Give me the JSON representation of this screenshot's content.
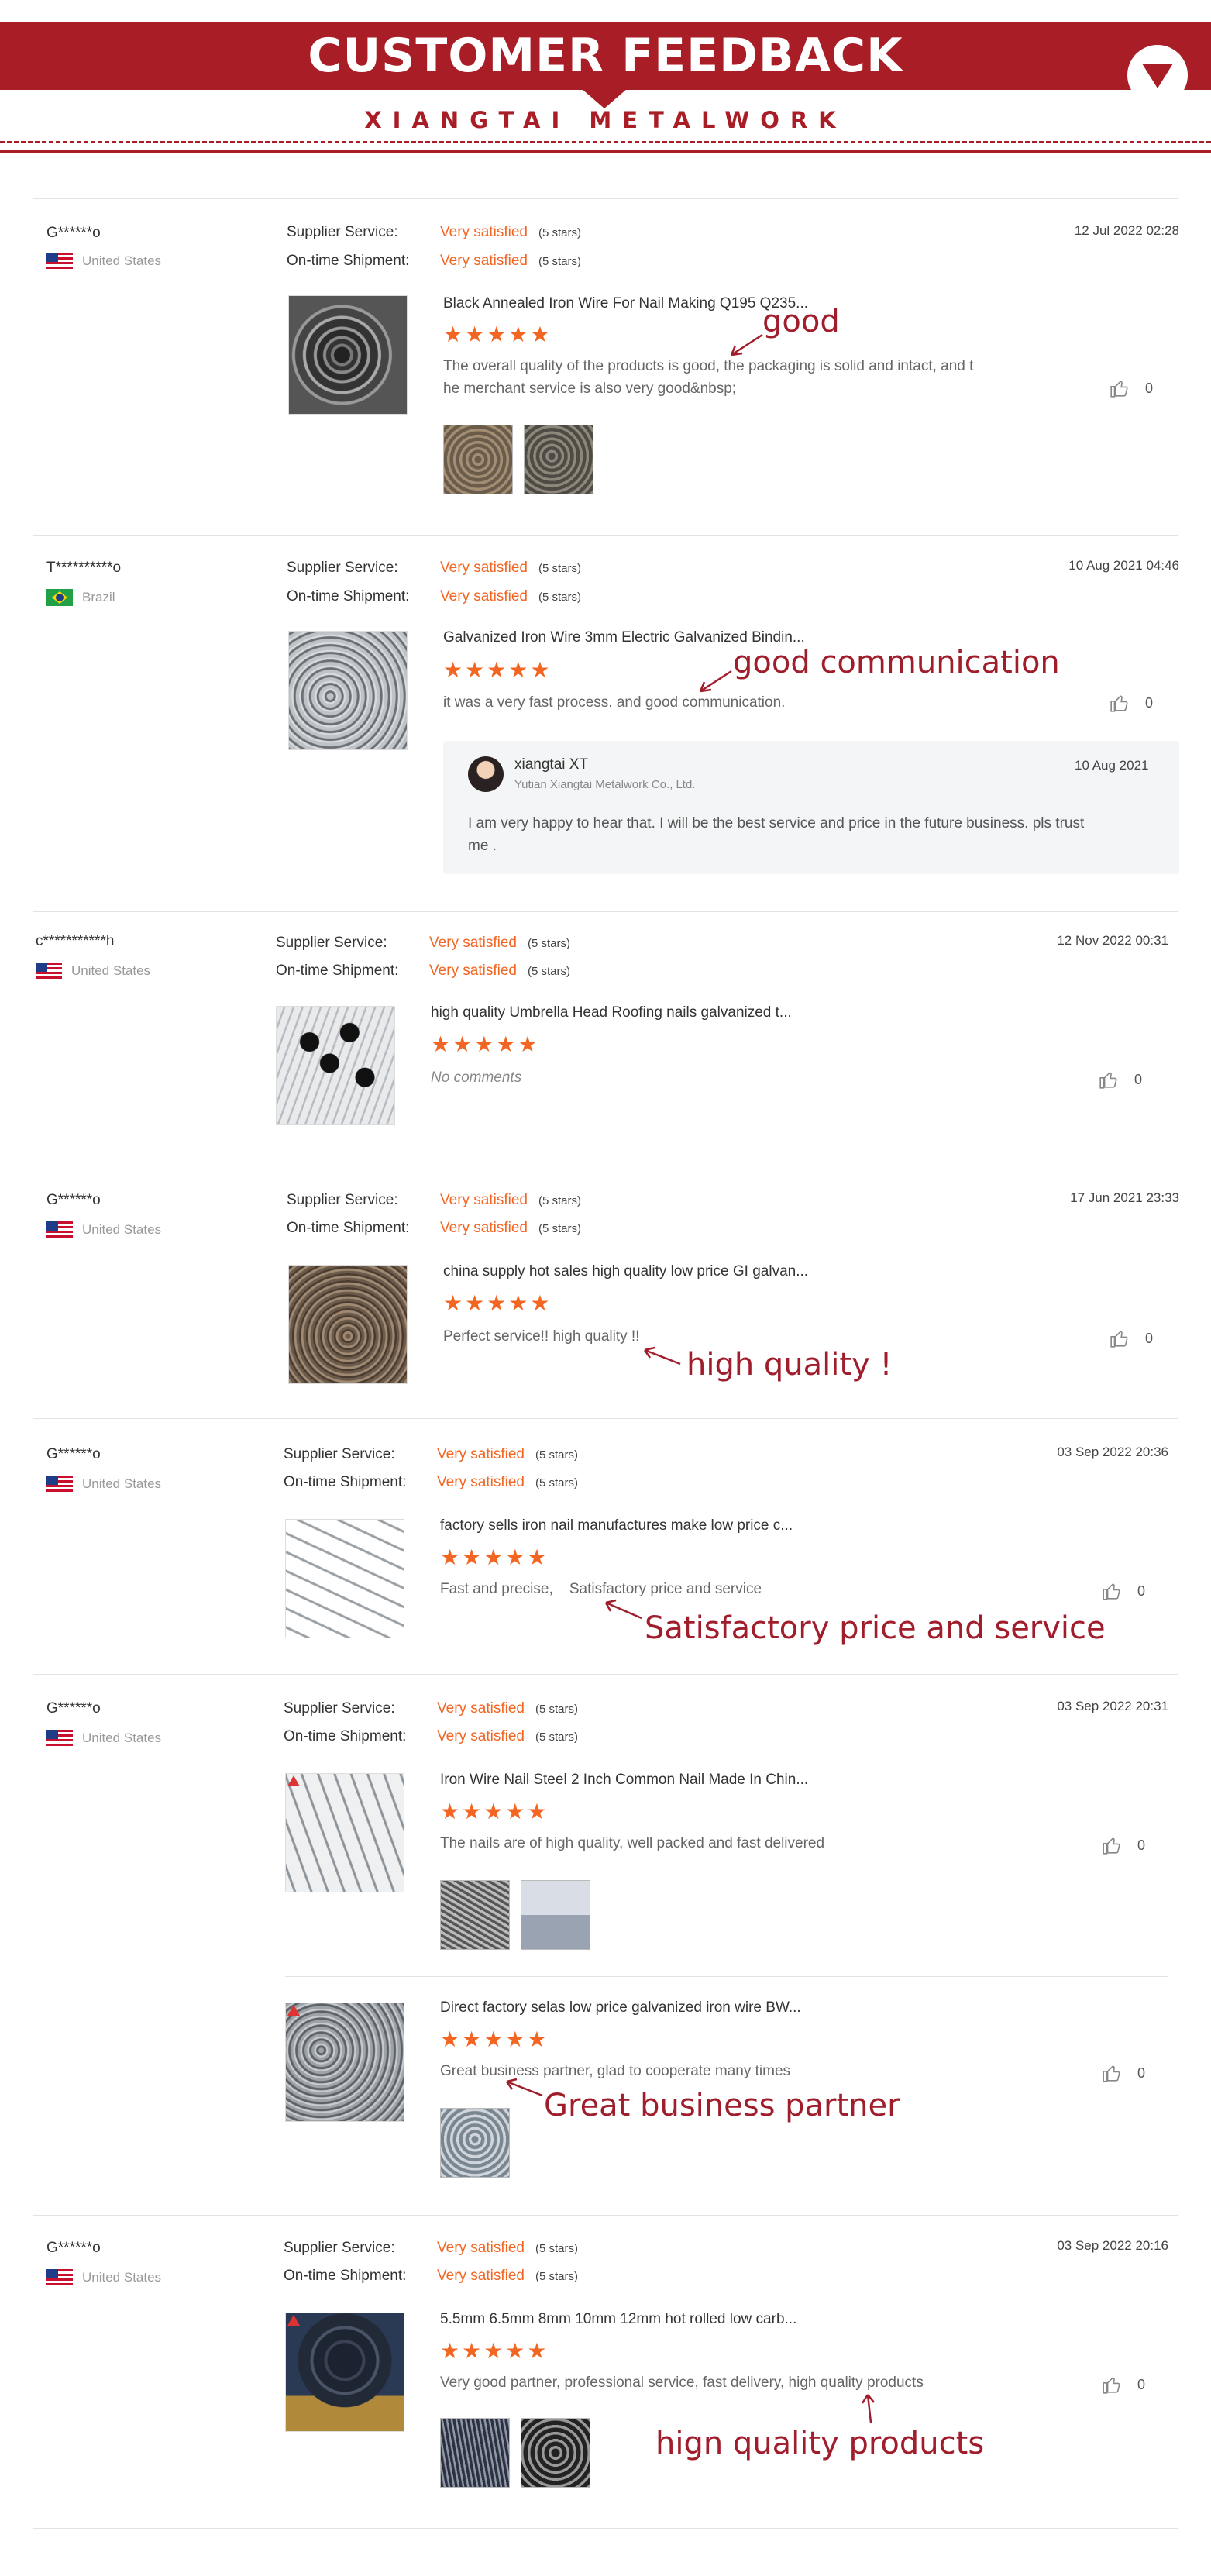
{
  "header": {
    "title": "CUSTOMER FEEDBACK",
    "subtitle": "XIANGTAI METALWORK"
  },
  "labels": {
    "supplier_service": "Supplier Service:",
    "ontime_shipment": "On-time Shipment:",
    "very_satisfied": "Very satisfied",
    "five_stars": "(5 stars)",
    "stars": "★★★★★"
  },
  "reviews": [
    {
      "user": "G******o",
      "country": "United States",
      "date": "12 Jul 2022 02:28",
      "items": [
        {
          "title": "Black Annealed Iron Wire For Nail Making Q195 Q235...",
          "comment_line1": "The overall quality of the products is good, the packaging is solid and intact, and t",
          "comment_line2": "he merchant service is also very good&nbsp;",
          "likes": "0",
          "note": "good"
        }
      ]
    },
    {
      "user": "T**********o",
      "country": "Brazil",
      "date": "10 Aug 2021 04:46",
      "items": [
        {
          "title": "Galvanized Iron Wire 3mm Electric Galvanized Bindin...",
          "comment_line1": "it was a very fast process. and good communication.",
          "likes": "0",
          "note": "good communication"
        }
      ],
      "reply": {
        "name": "xiangtai XT",
        "company": "Yutian Xiangtai Metalwork Co., Ltd.",
        "date": "10 Aug 2021",
        "text_line1": "I am very happy to hear that. I will be the best service and price in the future business. pls trust",
        "text_line2": "me ."
      }
    },
    {
      "user": "c***********h",
      "country": "United States",
      "date": "12 Nov 2022 00:31",
      "items": [
        {
          "title": "high quality Umbrella Head Roofing nails galvanized t...",
          "comment_line1": "No comments",
          "likes": "0"
        }
      ]
    },
    {
      "user": "G******o",
      "country": "United States",
      "date": "17 Jun 2021 23:33",
      "items": [
        {
          "title": "china supply hot sales high quality low price GI galvan...",
          "comment_line1": "Perfect service!! high quality !!",
          "likes": "0",
          "note": "high quality !"
        }
      ]
    },
    {
      "user": "G******o",
      "country": "United States",
      "date": "03 Sep 2022 20:36",
      "items": [
        {
          "title": "factory sells iron nail manufactures make low price c...",
          "comment_line1": "Fast and precise,    Satisfactory price and service",
          "likes": "0",
          "note": "Satisfactory price and service"
        }
      ]
    },
    {
      "user": "G******o",
      "country": "United States",
      "date": "03 Sep 2022 20:31",
      "items": [
        {
          "title": "Iron Wire Nail Steel 2 Inch Common Nail Made In Chin...",
          "comment_line1": "The nails are of high quality, well packed and fast delivered",
          "likes": "0"
        },
        {
          "title": "Direct factory selas low price galvanized iron wire BW...",
          "comment_line1": "Great business partner, glad to cooperate many times",
          "likes": "0",
          "note": "Great business partner"
        }
      ]
    },
    {
      "user": "G******o",
      "country": "United States",
      "date": "03 Sep 2022 20:16",
      "items": [
        {
          "title": "5.5mm 6.5mm 8mm 10mm 12mm hot rolled low carb...",
          "comment_line1": "Very good partner, professional service, fast delivery, high quality products",
          "likes": "0",
          "note": "hign quality products"
        }
      ]
    }
  ]
}
